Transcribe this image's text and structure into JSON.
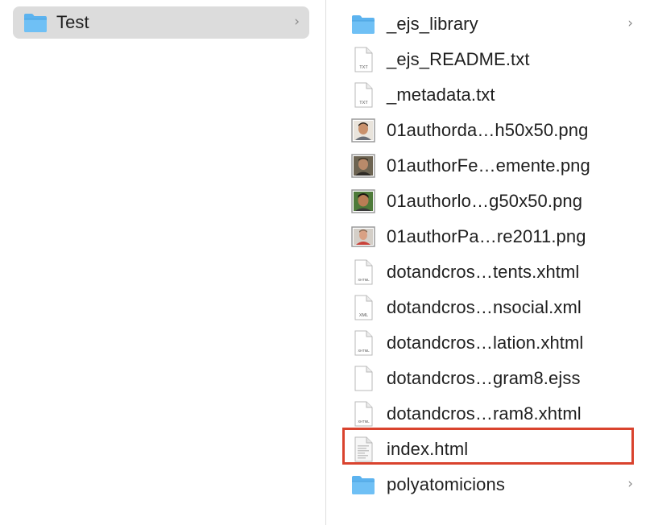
{
  "left_column": {
    "items": [
      {
        "label": "Test",
        "icon": "folder-icon",
        "selected": true
      }
    ]
  },
  "right_column": {
    "items": [
      {
        "label": "_ejs_library",
        "icon": "folder-icon",
        "has_children": true
      },
      {
        "label": "_ejs_README.txt",
        "icon": "txt-file-icon",
        "badge": "TXT"
      },
      {
        "label": "_metadata.txt",
        "icon": "txt-file-icon",
        "badge": "TXT"
      },
      {
        "label": "01authorda…h50x50.png",
        "icon": "png-thumbnail-icon"
      },
      {
        "label": "01authorFe…emente.png",
        "icon": "png-thumbnail-icon"
      },
      {
        "label": "01authorlo…g50x50.png",
        "icon": "png-thumbnail-icon"
      },
      {
        "label": "01authorPa…re2011.png",
        "icon": "png-thumbnail-icon"
      },
      {
        "label": "dotandcros…tents.xhtml",
        "icon": "xhtml-file-icon",
        "badge": "XHTML"
      },
      {
        "label": "dotandcros…nsocial.xml",
        "icon": "xml-file-icon",
        "badge": "XML"
      },
      {
        "label": "dotandcros…lation.xhtml",
        "icon": "xhtml-file-icon",
        "badge": "XHTML"
      },
      {
        "label": "dotandcros…gram8.ejss",
        "icon": "blank-file-icon"
      },
      {
        "label": "dotandcros…ram8.xhtml",
        "icon": "xhtml-file-icon",
        "badge": "XHTML"
      },
      {
        "label": "index.html",
        "icon": "html-file-icon",
        "highlighted": true
      },
      {
        "label": "polyatomicions",
        "icon": "folder-icon",
        "has_children": true
      }
    ]
  },
  "colors": {
    "folder": "#5cb3ef",
    "selection_bg": "#dcdcdc",
    "highlight_border": "#d9432e",
    "chevron": "#8a8a8a"
  }
}
